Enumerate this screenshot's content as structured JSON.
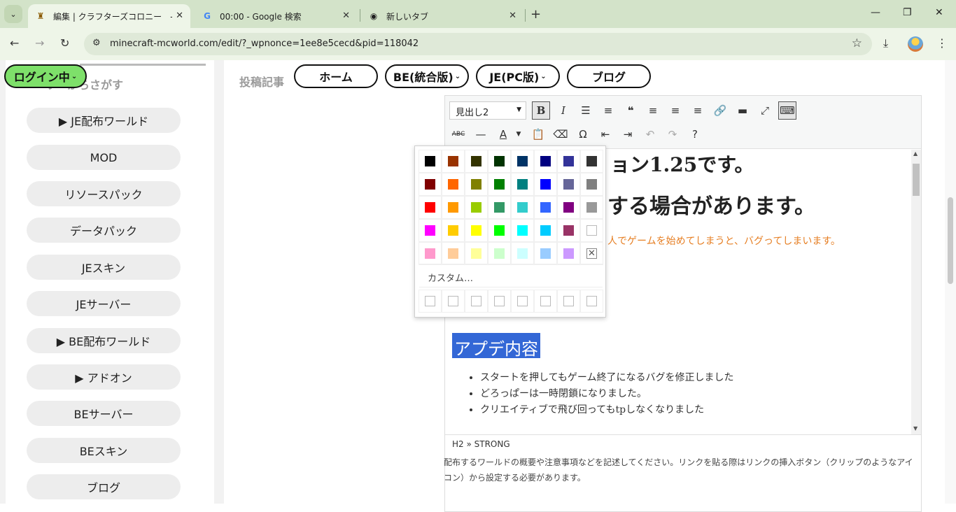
{
  "browser": {
    "tabs": [
      {
        "title": "編集 | クラフターズコロニー　-マイク",
        "icon": "site-favicon",
        "active": true
      },
      {
        "title": "00:00 - Google 検索",
        "icon": "google-g",
        "active": false
      },
      {
        "title": "新しいタブ",
        "icon": "chrome-logo",
        "active": false
      }
    ],
    "new_tab": "+",
    "url": "minecraft-mcworld.com/edit/?_wpnonce=1ee8e5cecd&pid=118042",
    "window_controls": {
      "minimize": "—",
      "maximize": "❐",
      "close": "✕"
    }
  },
  "header": {
    "login_label": "ログイン中",
    "post_label": "投稿記事",
    "nav": [
      {
        "label": "ホーム"
      },
      {
        "label": "BE(統合版)"
      },
      {
        "label": "JE(PC版)"
      },
      {
        "label": "ブログ"
      }
    ]
  },
  "sidebar": {
    "title": "リーからさがす",
    "items": [
      {
        "label": "▶ JE配布ワールド"
      },
      {
        "label": "MOD"
      },
      {
        "label": "リソースパック"
      },
      {
        "label": "データパック"
      },
      {
        "label": "JEスキン"
      },
      {
        "label": "JEサーバー"
      },
      {
        "label": "▶ BE配布ワールド"
      },
      {
        "label": "▶ アドオン"
      },
      {
        "label": "BEサーバー"
      },
      {
        "label": "BEスキン"
      },
      {
        "label": "ブログ"
      }
    ]
  },
  "editor": {
    "format_select": "見出し2",
    "heading_fragment_1": "ョン1.25です。",
    "heading_fragment_2": "する場合があります。",
    "warning_fragment": "人でゲームを始めてしまうと、バグってしまいます。",
    "selected_heading": "アプデ内容",
    "bullets": [
      "スタートを押してもゲーム終了になるバグを修正しました",
      "どろっぱーは一時閉鎖になりました。",
      "クリエイティブで飛び回ってもtpしなくなりました"
    ],
    "status_path": "H2 » STRONG",
    "help_text": "配布するワールドの概要や注意事項などを記述してください。リンクを貼る際はリンクの挿入ボタン（クリップのようなアイコン）から設定する必要があります。"
  },
  "color_picker": {
    "custom_label": "カスタム…",
    "rows": [
      [
        "#000000",
        "#993300",
        "#333300",
        "#003300",
        "#003366",
        "#000080",
        "#333399",
        "#333333"
      ],
      [
        "#800000",
        "#ff6600",
        "#808000",
        "#008000",
        "#008080",
        "#0000ff",
        "#666699",
        "#808080"
      ],
      [
        "#ff0000",
        "#ff9900",
        "#99cc00",
        "#339966",
        "#33cccc",
        "#3366ff",
        "#800080",
        "#999999"
      ],
      [
        "#ff00ff",
        "#ffcc00",
        "#ffff00",
        "#00ff00",
        "#00ffff",
        "#00ccff",
        "#993366",
        "#ffffff"
      ],
      [
        "#ff99cc",
        "#ffcc99",
        "#ffff99",
        "#ccffcc",
        "#ccffff",
        "#99ccff",
        "#cc99ff",
        "no-color"
      ]
    ]
  },
  "colors": {
    "tabbar_bg": "#d3e3c9",
    "login_green": "#7ee06a",
    "selection_blue": "#3367d6",
    "warning_orange": "#e67e22"
  }
}
